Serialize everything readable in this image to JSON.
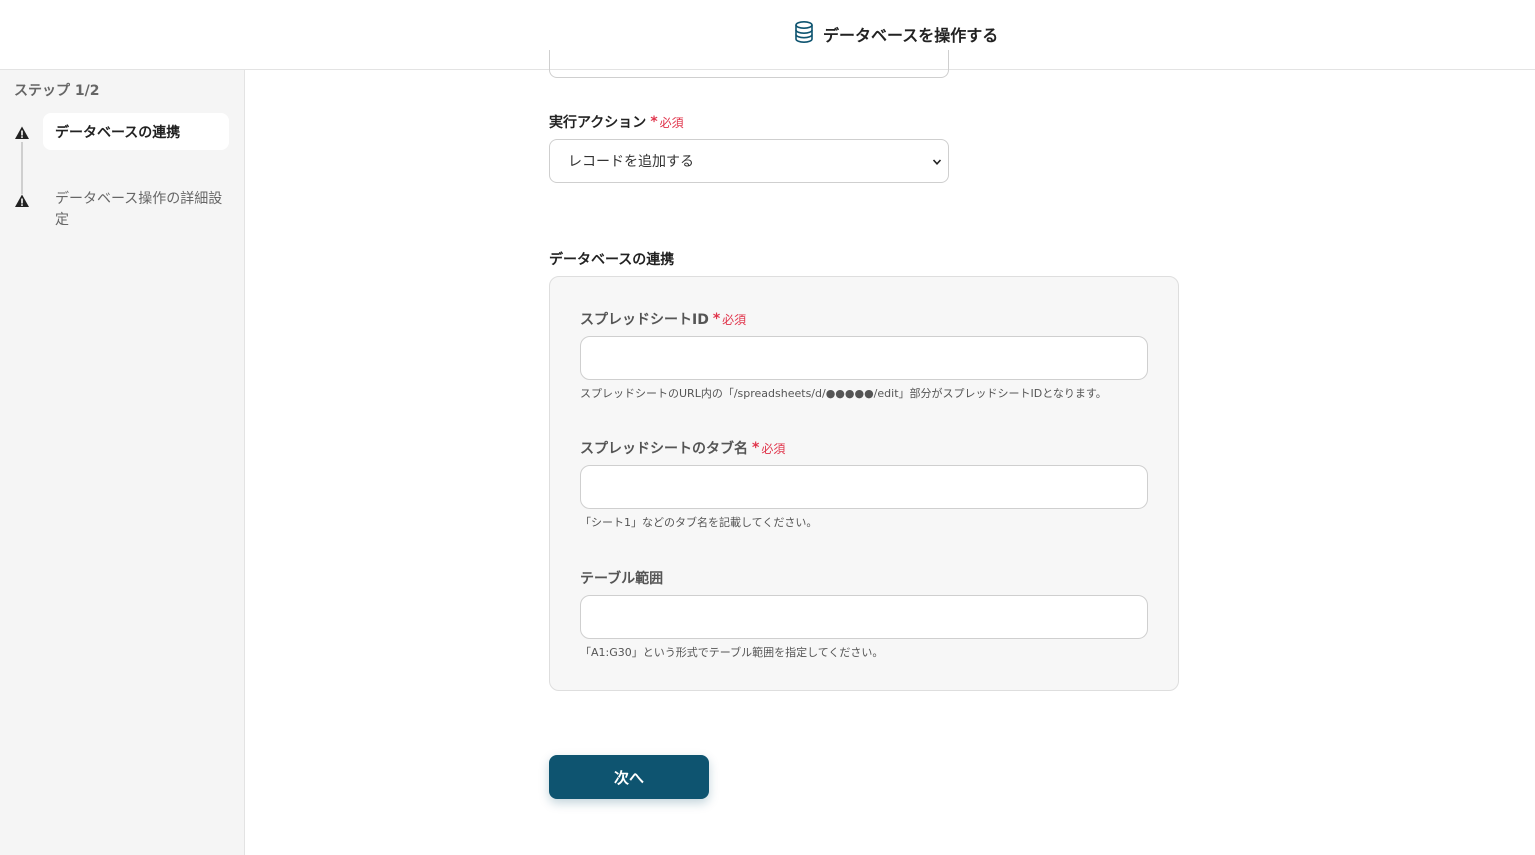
{
  "header": {
    "title": "データベースを操作する",
    "icon": "database-icon"
  },
  "sidebar": {
    "step_label": "ステップ 1/2",
    "steps": [
      {
        "label": "データベースの連携",
        "status_icon": "warning-icon",
        "active": true
      },
      {
        "label": "データベース操作の詳細設定",
        "status_icon": "warning-icon",
        "active": false
      }
    ]
  },
  "form": {
    "action": {
      "label": "実行アクション",
      "required": "必須",
      "value": "レコードを追加する"
    },
    "section_title": "データベースの連携",
    "spreadsheet_id": {
      "label": "スプレッドシートID",
      "required": "必須",
      "value": "",
      "help": "スプレッドシートのURL内の「/spreadsheets/d/●●●●●/edit」部分がスプレッドシートIDとなります。"
    },
    "tab_name": {
      "label": "スプレッドシートのタブ名",
      "required": "必須",
      "value": "",
      "help": "「シート1」などのタブ名を記載してください。"
    },
    "table_range": {
      "label": "テーブル範囲",
      "value": "",
      "help": "「A1:G30」という形式でテーブル範囲を指定してください。"
    },
    "next_button": "次へ"
  },
  "colors": {
    "primary": "#0e5470",
    "required": "#e0344b",
    "sidebar_bg": "#f5f5f5",
    "panel_bg": "#f7f7f7"
  }
}
